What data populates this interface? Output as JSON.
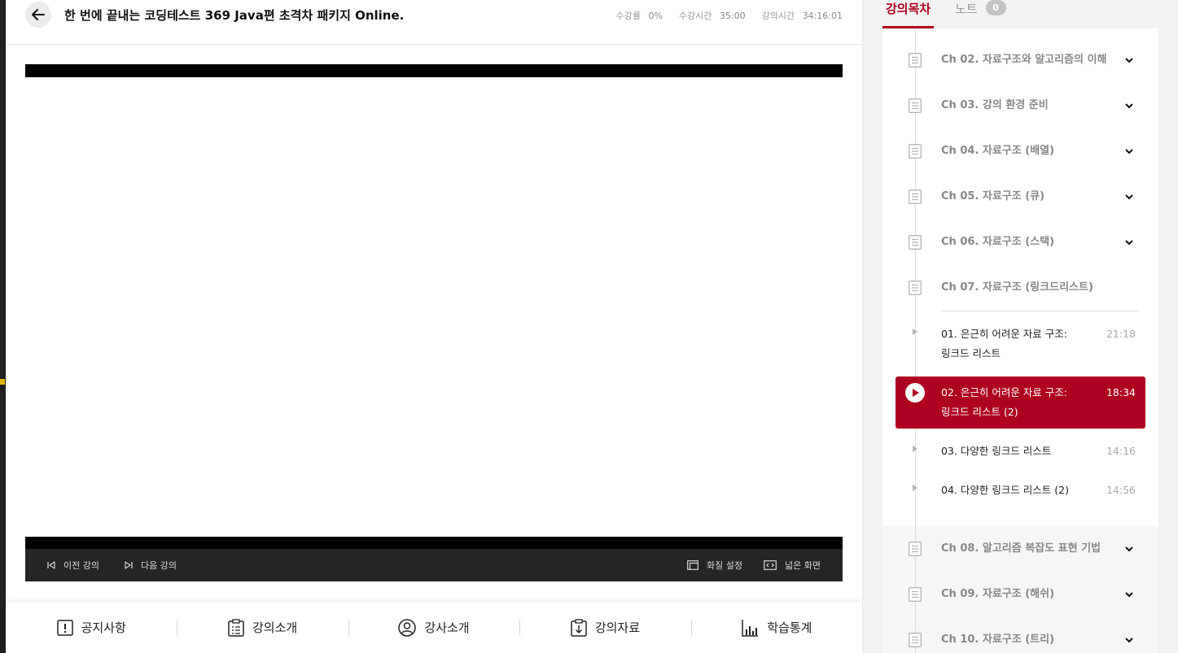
{
  "header": {
    "title": "한 번에 끝내는 코딩테스트 369 Java편 초격차 패키지 Online.",
    "stats": [
      {
        "label": "수강률",
        "value": "0%"
      },
      {
        "label": "수강시간",
        "value": "35:00"
      },
      {
        "label": "강의시간",
        "value": "34:16:01"
      }
    ]
  },
  "player": {
    "prev_label": "이전 강의",
    "next_label": "다음 강의",
    "quality_label": "화질 설정",
    "wide_label": "넓은 화면"
  },
  "bottom_menu": [
    {
      "label": "공지사항",
      "icon": "notice-icon"
    },
    {
      "label": "강의소개",
      "icon": "clipboard-list-icon"
    },
    {
      "label": "강사소개",
      "icon": "user-icon"
    },
    {
      "label": "강의자료",
      "icon": "download-doc-icon"
    },
    {
      "label": "학습통계",
      "icon": "stats-icon"
    }
  ],
  "tabs": {
    "curriculum": "강의목차",
    "notes": "노트",
    "notes_count": "0"
  },
  "chapters_top": [
    {
      "label": "Ch 02. 자료구조와 알고리즘의 이해"
    },
    {
      "label": "Ch 03. 강의 환경 준비"
    },
    {
      "label": "Ch 04. 자료구조 (배열)"
    },
    {
      "label": "Ch 05. 자료구조 (큐)"
    },
    {
      "label": "Ch 06. 자료구조 (스택)"
    }
  ],
  "open_chapter": {
    "label": "Ch 07. 자료구조 (링크드리스트)"
  },
  "lessons": [
    {
      "title": "01. 은근히 어려운 자료 구조: 링크드 리스트",
      "duration": "21:18"
    },
    {
      "title": "02. 은근히 어려운 자료 구조: 링크드 리스트 (2)",
      "duration": "18:34"
    },
    {
      "title": "03. 다양한 링크드 리스트",
      "duration": "14:16"
    },
    {
      "title": "04. 다양한 링크드 리스트 (2)",
      "duration": "14:56"
    }
  ],
  "chapters_bottom": [
    {
      "label": "Ch 08. 알고리즘 복잡도 표현 기법"
    },
    {
      "label": "Ch 09. 자료구조 (해쉬)"
    },
    {
      "label": "Ch 10. 자료구조 (트리)"
    }
  ],
  "colors": {
    "accent": "#ae0020",
    "tab_active": "#b0001c"
  }
}
